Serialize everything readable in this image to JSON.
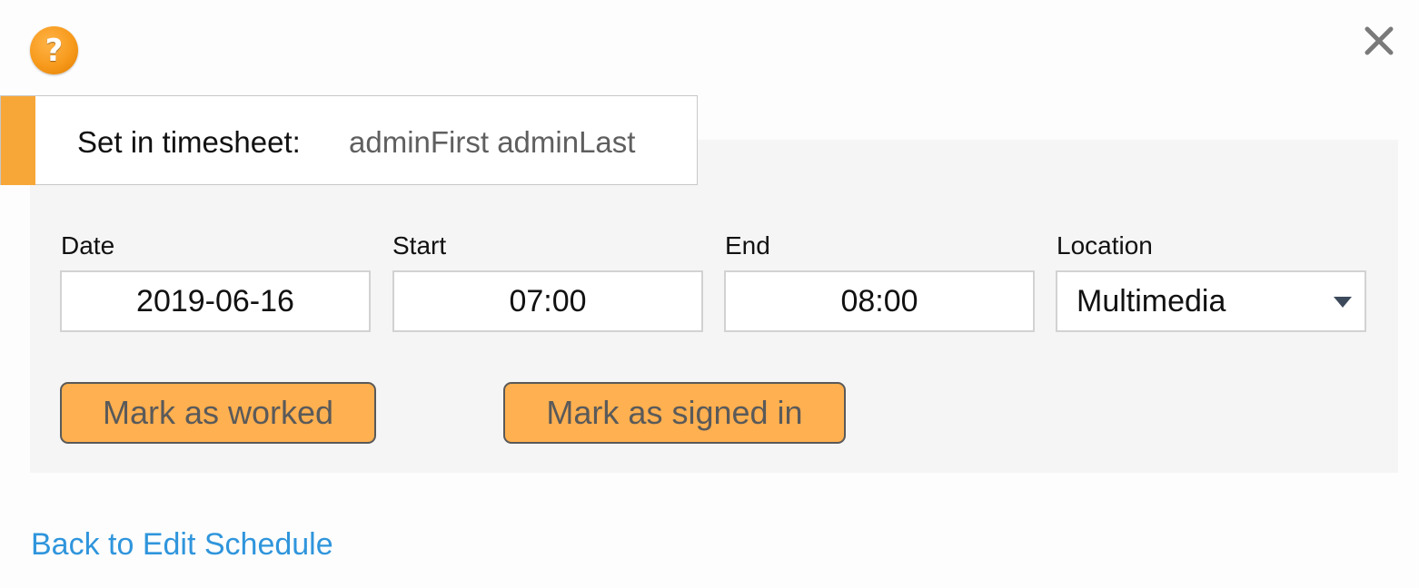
{
  "header": {
    "label": "Set in timesheet:",
    "user_name": "adminFirst adminLast"
  },
  "icons": {
    "help": "question-mark-icon",
    "close": "close-icon"
  },
  "help_glyph": "?",
  "fields": {
    "date": {
      "label": "Date",
      "value": "2019-06-16"
    },
    "start": {
      "label": "Start",
      "value": "07:00"
    },
    "end": {
      "label": "End",
      "value": "08:00"
    },
    "location": {
      "label": "Location",
      "value": "Multimedia"
    }
  },
  "actions": {
    "mark_worked": "Mark as worked",
    "mark_signed_in": "Mark as signed in"
  },
  "back_link": "Back to Edit Schedule",
  "colors": {
    "accent": "#f7a738",
    "button_bg": "#ffb050",
    "link": "#2f95dc",
    "panel_bg": "#f5f5f5"
  }
}
